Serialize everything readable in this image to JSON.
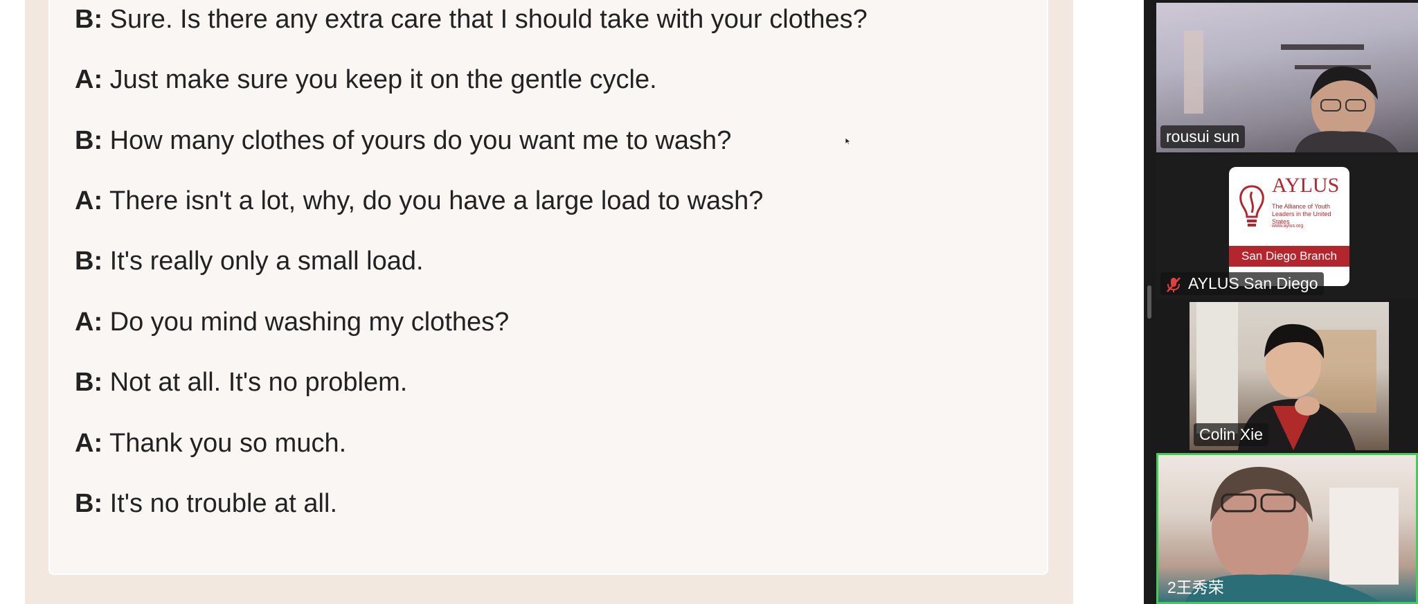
{
  "dialogue": [
    {
      "speaker": "B:",
      "text": "Sure. Is there any extra care that I should take with your clothes?"
    },
    {
      "speaker": "A:",
      "text": "Just make sure you keep it on the gentle cycle."
    },
    {
      "speaker": "B:",
      "text": "How many clothes of yours do you want me to wash?"
    },
    {
      "speaker": "A:",
      "text": "There isn't a lot, why, do you have a large load to wash?"
    },
    {
      "speaker": "B:",
      "text": "It's really only a small load."
    },
    {
      "speaker": "A:",
      "text": "Do you mind washing my clothes?"
    },
    {
      "speaker": "B:",
      "text": "Not at all. It's no problem."
    },
    {
      "speaker": "A:",
      "text": "Thank you so much."
    },
    {
      "speaker": "B:",
      "text": "It's no trouble at all."
    }
  ],
  "participants": [
    {
      "name": "rousui sun",
      "muted": false,
      "icon": "video-feed"
    },
    {
      "name": "AYLUS San Diego",
      "muted": true,
      "icon": "muted-mic-icon"
    },
    {
      "name": "Colin Xie",
      "muted": false,
      "icon": "video-feed"
    },
    {
      "name": "2王秀荣",
      "muted": false,
      "icon": "video-feed",
      "active_speaker": true
    }
  ],
  "aylus_logo": {
    "name": "AYLUS",
    "tagline": "The Alliance of Youth Leaders in the United States",
    "url": "www.aylus.org",
    "branch": "San Diego Branch",
    "motto": "Leadership Integrity Innovation"
  },
  "colors": {
    "active_speaker_border": "#3fcf57",
    "logo_red": "#b3262e",
    "muted_red": "#e0413f"
  }
}
